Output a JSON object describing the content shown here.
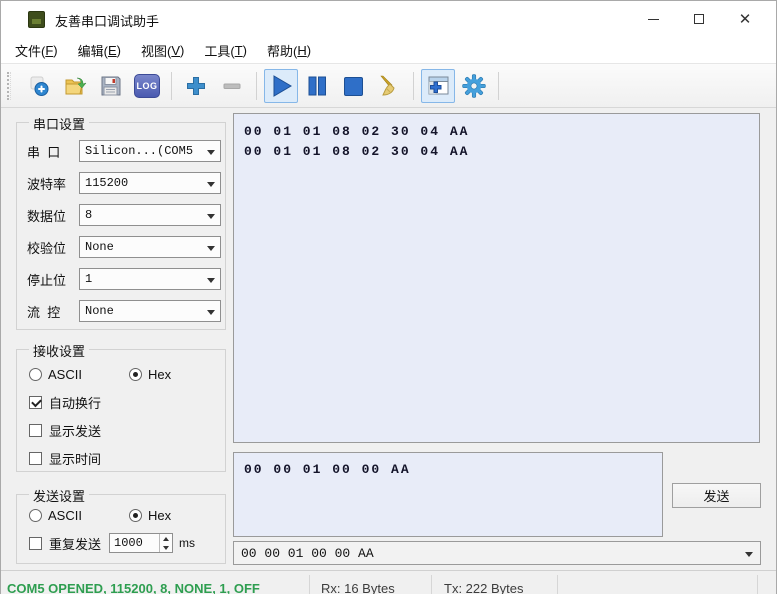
{
  "window": {
    "title": "友善串口调试助手",
    "close_glyph": "✕"
  },
  "menu": {
    "items": [
      {
        "pre": "文件(",
        "key": "F",
        "post": ")"
      },
      {
        "pre": "编辑(",
        "key": "E",
        "post": ")"
      },
      {
        "pre": "视图(",
        "key": "V",
        "post": ")"
      },
      {
        "pre": "工具(",
        "key": "T",
        "post": ")"
      },
      {
        "pre": "帮助(",
        "key": "H",
        "post": ")"
      }
    ]
  },
  "toolbar": {
    "log_label": "LOG"
  },
  "serial_settings": {
    "title": "串口设置",
    "rows": [
      {
        "label": "串  口",
        "value": "Silicon...(COM5"
      },
      {
        "label": "波特率",
        "value": "115200"
      },
      {
        "label": "数据位",
        "value": "8"
      },
      {
        "label": "校验位",
        "value": "None"
      },
      {
        "label": "停止位",
        "value": "1"
      },
      {
        "label": "流  控",
        "value": "None"
      }
    ]
  },
  "receive_settings": {
    "title": "接收设置",
    "ascii_label": "ASCII",
    "hex_label": "Hex",
    "selected_mode": "Hex",
    "checkboxes": [
      {
        "label": "自动换行",
        "checked": true
      },
      {
        "label": "显示发送",
        "checked": false
      },
      {
        "label": "显示时间",
        "checked": false
      }
    ]
  },
  "send_settings": {
    "title": "发送设置",
    "ascii_label": "ASCII",
    "hex_label": "Hex",
    "selected_mode": "Hex",
    "repeat_label": "重复发送",
    "repeat_checked": false,
    "interval_value": "1000",
    "interval_unit": "ms"
  },
  "receive_area": {
    "lines": [
      "00 01 01 08 02 30 04 AA",
      "00 01 01 08 02 30 04 AA"
    ]
  },
  "send_area": {
    "text": "00 00 01 00 00 AA"
  },
  "send_button_label": "发送",
  "history_combo": {
    "value": "00 00 01 00 00 AA"
  },
  "status_bar": {
    "connection": "COM5 OPENED, 115200, 8, NONE, 1, OFF",
    "rx": "Rx: 16 Bytes",
    "tx": "Tx: 222 Bytes"
  },
  "colors": {
    "accent_blue": "#2f6fc8",
    "toolbar_selected_border": "#86b7e8",
    "receive_bg": "#e8ecf8",
    "status_green": "#2e9e50"
  }
}
